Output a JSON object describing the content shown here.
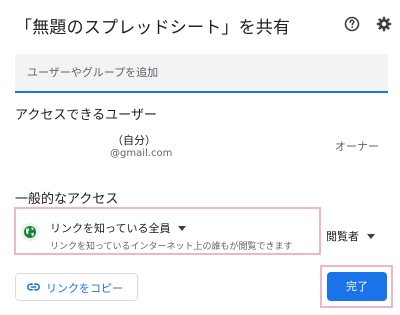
{
  "dialog": {
    "title": "「無題のスプレッドシート」を共有"
  },
  "header_icons": [
    "help-icon",
    "gear-icon"
  ],
  "add_people": {
    "placeholder": "ユーザーやグループを追加"
  },
  "access_users": {
    "heading": "アクセスできるユーザー",
    "users": [
      {
        "name": "（自分）",
        "email": "@gmail.com",
        "role": "オーナー"
      }
    ]
  },
  "general_access": {
    "heading": "一般的なアクセス",
    "link_setting": "リンクを知っている全員",
    "description": "リンクを知っているインターネット上の誰もが閲覧できます",
    "role": "閲覧者",
    "icon": "globe-icon"
  },
  "actions": {
    "copy_link_label": "リンクをコピー",
    "done_label": "完了"
  },
  "colors": {
    "accent": "#1a73e8",
    "highlight": "#f0b6c8",
    "globe": "#188038"
  }
}
